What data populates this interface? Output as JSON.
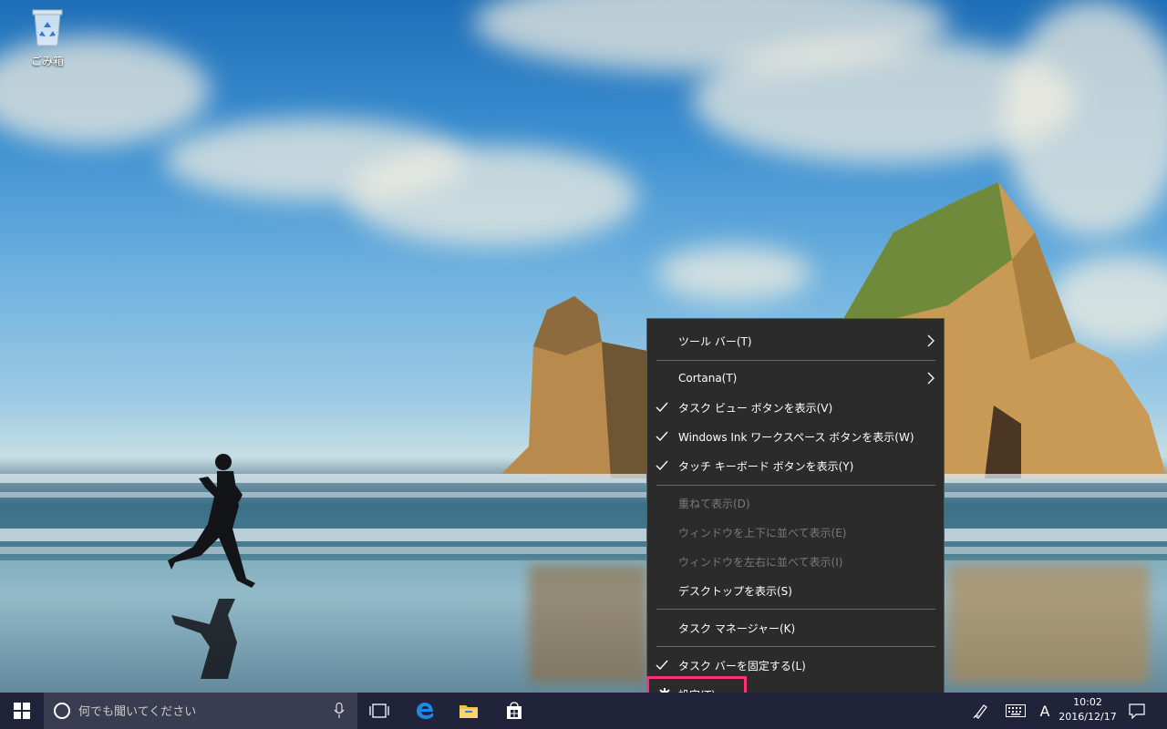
{
  "desktop": {
    "recycle_bin_label": "ごみ箱"
  },
  "context_menu": {
    "items": [
      {
        "label": "ツール バー(T)",
        "checked": false,
        "submenu": true,
        "enabled": true
      },
      {
        "label": "Cortana(T)",
        "checked": false,
        "submenu": true,
        "enabled": true
      },
      {
        "label": "タスク ビュー ボタンを表示(V)",
        "checked": true,
        "submenu": false,
        "enabled": true
      },
      {
        "label": "Windows Ink ワークスペース ボタンを表示(W)",
        "checked": true,
        "submenu": false,
        "enabled": true
      },
      {
        "label": "タッチ キーボード ボタンを表示(Y)",
        "checked": true,
        "submenu": false,
        "enabled": true
      },
      {
        "label": "重ねて表示(D)",
        "checked": false,
        "submenu": false,
        "enabled": false
      },
      {
        "label": "ウィンドウを上下に並べて表示(E)",
        "checked": false,
        "submenu": false,
        "enabled": false
      },
      {
        "label": "ウィンドウを左右に並べて表示(I)",
        "checked": false,
        "submenu": false,
        "enabled": false
      },
      {
        "label": "デスクトップを表示(S)",
        "checked": false,
        "submenu": false,
        "enabled": true
      },
      {
        "label": "タスク マネージャー(K)",
        "checked": false,
        "submenu": false,
        "enabled": true
      },
      {
        "label": "タスク バーを固定する(L)",
        "checked": true,
        "submenu": false,
        "enabled": true
      },
      {
        "label": "設定(T)",
        "checked": false,
        "submenu": false,
        "enabled": true,
        "icon": "gear-icon",
        "highlighted": true
      }
    ],
    "highlight_color": "#ff2f7d"
  },
  "taskbar": {
    "search_placeholder": "何でも聞いてください",
    "ime_indicator": "A",
    "time": "10:02",
    "date": "2016/12/17",
    "icons": [
      "windows-logo-icon",
      "cortana-icon",
      "microphone-icon",
      "task-view-icon",
      "edge-icon",
      "file-explorer-icon",
      "store-icon",
      "windows-ink-icon",
      "keyboard-icon",
      "notification-icon"
    ],
    "background_color": "#20233a"
  }
}
